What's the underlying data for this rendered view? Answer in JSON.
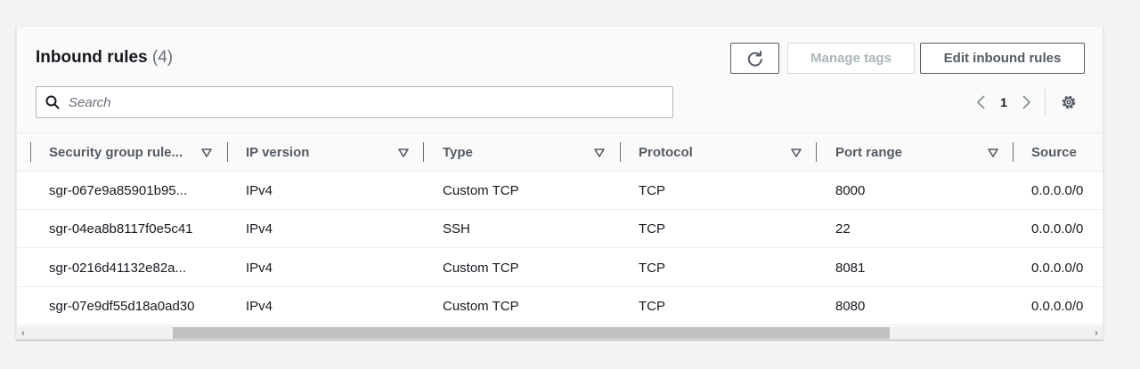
{
  "header": {
    "title": "Inbound rules",
    "count": "(4)",
    "refresh_icon": "refresh-icon",
    "manage_tags_label": "Manage tags",
    "edit_label": "Edit inbound rules"
  },
  "search": {
    "placeholder": "Search",
    "value": ""
  },
  "pager": {
    "current_page": "1"
  },
  "table": {
    "columns": [
      "Security group rule...",
      "IP version",
      "Type",
      "Protocol",
      "Port range",
      "Source"
    ],
    "rows": [
      [
        "sgr-067e9a85901b95...",
        "IPv4",
        "Custom TCP",
        "TCP",
        "8000",
        "0.0.0.0/0"
      ],
      [
        "sgr-04ea8b8117f0e5c41",
        "IPv4",
        "SSH",
        "TCP",
        "22",
        "0.0.0.0/0"
      ],
      [
        "sgr-0216d41132e82a...",
        "IPv4",
        "Custom TCP",
        "TCP",
        "8081",
        "0.0.0.0/0"
      ],
      [
        "sgr-07e9df55d18a0ad30",
        "IPv4",
        "Custom TCP",
        "TCP",
        "8080",
        "0.0.0.0/0"
      ]
    ]
  },
  "scrollbar": {
    "left_arrow": "‹",
    "right_arrow": "›"
  },
  "colors": {
    "primary_text": "#16191f",
    "secondary_text": "#545b64",
    "disabled": "#aab7b8"
  }
}
